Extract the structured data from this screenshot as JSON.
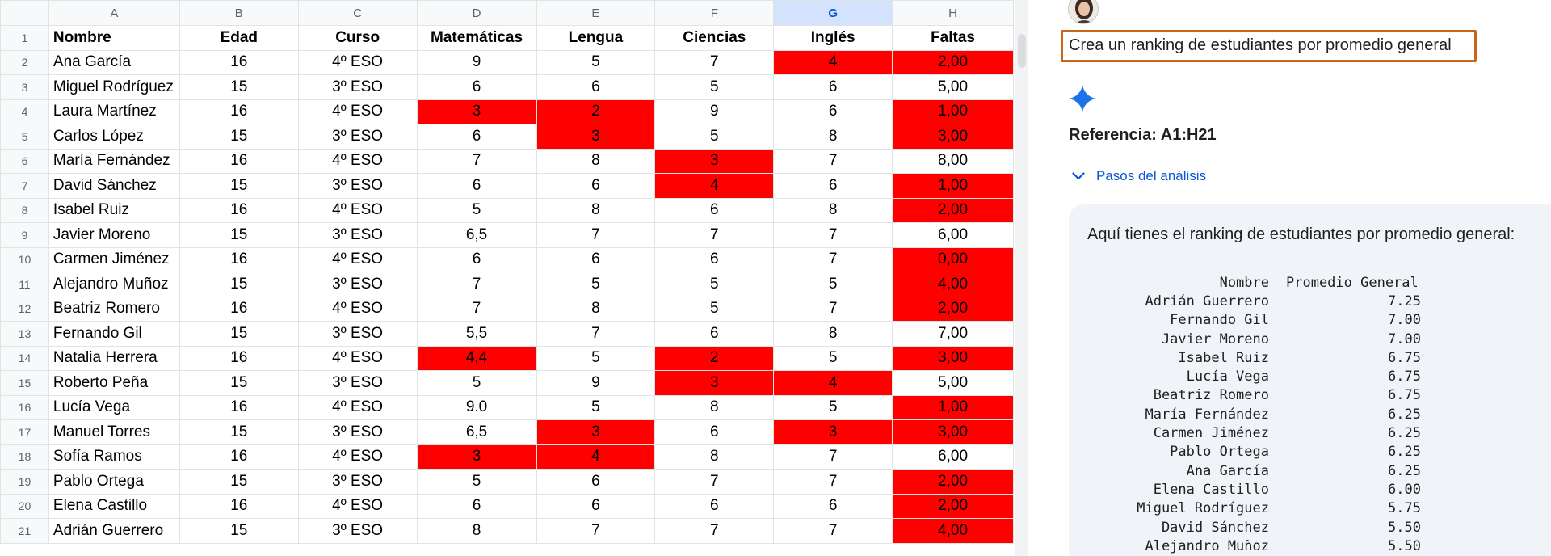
{
  "sheet": {
    "columns": [
      "A",
      "B",
      "C",
      "D",
      "E",
      "F",
      "G",
      "H"
    ],
    "selected_column": "G",
    "rows": [
      {
        "n": "1",
        "cells": [
          "Nombre",
          "Edad",
          "Curso",
          "Matemáticas",
          "Lengua",
          "Ciencias",
          "Inglés",
          "Faltas"
        ],
        "red": []
      },
      {
        "n": "2",
        "cells": [
          "Ana García",
          "16",
          "4º ESO",
          "9",
          "5",
          "7",
          "4",
          "2,00"
        ],
        "red": [
          6,
          7
        ]
      },
      {
        "n": "3",
        "cells": [
          "Miguel Rodríguez",
          "15",
          "3º ESO",
          "6",
          "6",
          "5",
          "6",
          "5,00"
        ],
        "red": []
      },
      {
        "n": "4",
        "cells": [
          "Laura Martínez",
          "16",
          "4º ESO",
          "3",
          "2",
          "9",
          "6",
          "1,00"
        ],
        "red": [
          3,
          4,
          7
        ]
      },
      {
        "n": "5",
        "cells": [
          "Carlos López",
          "15",
          "3º ESO",
          "6",
          "3",
          "5",
          "8",
          "3,00"
        ],
        "red": [
          4,
          7
        ]
      },
      {
        "n": "6",
        "cells": [
          "María Fernández",
          "16",
          "4º ESO",
          "7",
          "8",
          "3",
          "7",
          "8,00"
        ],
        "red": [
          5
        ]
      },
      {
        "n": "7",
        "cells": [
          "David Sánchez",
          "15",
          "3º ESO",
          "6",
          "6",
          "4",
          "6",
          "1,00"
        ],
        "red": [
          5,
          7
        ]
      },
      {
        "n": "8",
        "cells": [
          "Isabel Ruiz",
          "16",
          "4º ESO",
          "5",
          "8",
          "6",
          "8",
          "2,00"
        ],
        "red": [
          7
        ]
      },
      {
        "n": "9",
        "cells": [
          "Javier Moreno",
          "15",
          "3º ESO",
          "6,5",
          "7",
          "7",
          "7",
          "6,00"
        ],
        "red": []
      },
      {
        "n": "10",
        "cells": [
          "Carmen Jiménez",
          "16",
          "4º ESO",
          "6",
          "6",
          "6",
          "7",
          "0,00"
        ],
        "red": [
          7
        ]
      },
      {
        "n": "11",
        "cells": [
          "Alejandro Muñoz",
          "15",
          "3º ESO",
          "7",
          "5",
          "5",
          "5",
          "4,00"
        ],
        "red": [
          7
        ]
      },
      {
        "n": "12",
        "cells": [
          "Beatriz Romero",
          "16",
          "4º ESO",
          "7",
          "8",
          "5",
          "7",
          "2,00"
        ],
        "red": [
          7
        ]
      },
      {
        "n": "13",
        "cells": [
          "Fernando Gil",
          "15",
          "3º ESO",
          "5,5",
          "7",
          "6",
          "8",
          "7,00"
        ],
        "red": []
      },
      {
        "n": "14",
        "cells": [
          "Natalia Herrera",
          "16",
          "4º ESO",
          "4,4",
          "5",
          "2",
          "5",
          "3,00"
        ],
        "red": [
          3,
          5,
          7
        ]
      },
      {
        "n": "15",
        "cells": [
          "Roberto Peña",
          "15",
          "3º ESO",
          "5",
          "9",
          "3",
          "4",
          "5,00"
        ],
        "red": [
          5,
          6
        ]
      },
      {
        "n": "16",
        "cells": [
          "Lucía Vega",
          "16",
          "4º ESO",
          "9.0",
          "5",
          "8",
          "5",
          "1,00"
        ],
        "red": [
          7
        ]
      },
      {
        "n": "17",
        "cells": [
          "Manuel Torres",
          "15",
          "3º ESO",
          "6,5",
          "3",
          "6",
          "3",
          "3,00"
        ],
        "red": [
          4,
          6,
          7
        ]
      },
      {
        "n": "18",
        "cells": [
          "Sofía Ramos",
          "16",
          "4º ESO",
          "3",
          "4",
          "8",
          "7",
          "6,00"
        ],
        "red": [
          3,
          4
        ]
      },
      {
        "n": "19",
        "cells": [
          "Pablo Ortega",
          "15",
          "3º ESO",
          "5",
          "6",
          "7",
          "7",
          "2,00"
        ],
        "red": [
          7
        ]
      },
      {
        "n": "20",
        "cells": [
          "Elena Castillo",
          "16",
          "4º ESO",
          "6",
          "6",
          "6",
          "6",
          "2,00"
        ],
        "red": [
          7
        ]
      },
      {
        "n": "21",
        "cells": [
          "Adrián Guerrero",
          "15",
          "3º ESO",
          "8",
          "7",
          "7",
          "7",
          "4,00"
        ],
        "red": [
          7
        ]
      }
    ],
    "highlight_color": "#ff0000"
  },
  "panel": {
    "prompt": "Crea un ranking de estudiantes por promedio general",
    "reference": "Referencia: A1:H21",
    "steps_label": "Pasos del análisis",
    "intro": "Aquí tienes el ranking de estudiantes por promedio general:",
    "ranking_header": {
      "name": "Nombre",
      "value": "Promedio General"
    },
    "ranking": [
      {
        "name": "Adrián Guerrero",
        "value": "7.25"
      },
      {
        "name": "Fernando Gil",
        "value": "7.00"
      },
      {
        "name": "Javier Moreno",
        "value": "7.00"
      },
      {
        "name": "Isabel Ruiz",
        "value": "6.75"
      },
      {
        "name": "Lucía Vega",
        "value": "6.75"
      },
      {
        "name": "Beatriz Romero",
        "value": "6.75"
      },
      {
        "name": "María Fernández",
        "value": "6.25"
      },
      {
        "name": "Carmen Jiménez",
        "value": "6.25"
      },
      {
        "name": "Pablo Ortega",
        "value": "6.25"
      },
      {
        "name": "Ana García",
        "value": "6.25"
      },
      {
        "name": "Elena Castillo",
        "value": "6.00"
      },
      {
        "name": "Miguel Rodríguez",
        "value": "5.75"
      },
      {
        "name": "David Sánchez",
        "value": "5.50"
      },
      {
        "name": "Alejandro Muñoz",
        "value": "5.50"
      }
    ],
    "prompt_border_color": "#c8651b",
    "sparkle_color": "#1a73e8",
    "icons": {
      "avatar": "user-avatar",
      "sparkle": "gemini-sparkle-icon",
      "steps": "chevron-down-icon"
    }
  }
}
